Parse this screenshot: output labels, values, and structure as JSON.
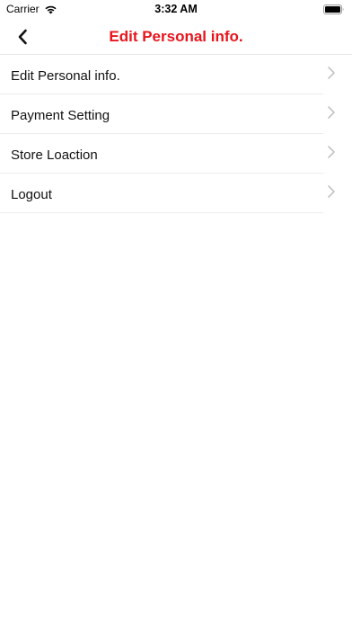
{
  "status_bar": {
    "carrier": "Carrier",
    "time": "3:32 AM",
    "icons": [
      "wifi-icon",
      "battery-icon"
    ]
  },
  "nav": {
    "title": "Edit Personal info.",
    "back_icon": "chevron-left-icon",
    "title_color": "#e8141c"
  },
  "menu": {
    "items": [
      {
        "label": "Edit Personal info.",
        "icon": "chevron-right-icon"
      },
      {
        "label": "Payment Setting",
        "icon": "chevron-right-icon"
      },
      {
        "label": "Store Loaction",
        "icon": "chevron-right-icon"
      },
      {
        "label": "Logout",
        "icon": "chevron-right-icon"
      }
    ]
  }
}
